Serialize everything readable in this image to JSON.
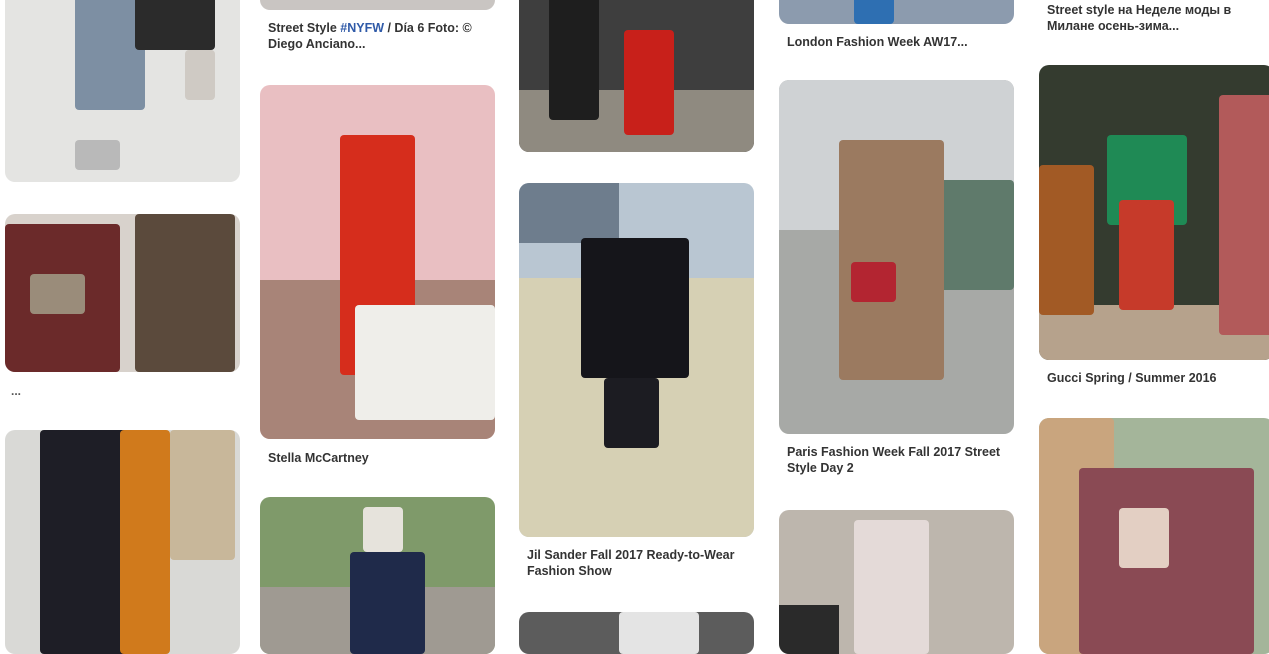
{
  "pins": [
    {
      "id": "c1-top",
      "caption": ""
    },
    {
      "id": "c1-mid",
      "caption": ""
    },
    {
      "id": "c1-bottom",
      "caption": ""
    },
    {
      "id": "c2-top",
      "caption_parts": [
        "Street Style ",
        "#NYFW",
        " / Día 6 Foto: © Diego Anciano..."
      ]
    },
    {
      "id": "c2-mid",
      "caption": "Stella McCartney"
    },
    {
      "id": "c2-bottom",
      "caption": ""
    },
    {
      "id": "c3-top",
      "caption": ""
    },
    {
      "id": "c3-mid",
      "caption": "Jil Sander Fall 2017 Ready-to-Wear Fashion Show"
    },
    {
      "id": "c3-bottom",
      "caption": ""
    },
    {
      "id": "c4-top",
      "caption": "London Fashion Week AW17..."
    },
    {
      "id": "c4-mid",
      "caption": "Paris Fashion Week Fall 2017 Street Style Day 2"
    },
    {
      "id": "c4-bottom",
      "caption": ""
    },
    {
      "id": "c5-top",
      "caption": "Street style на Неделе моды в Милане осень-зима..."
    },
    {
      "id": "c5-mid",
      "caption": "Gucci Spring / Summer 2016"
    },
    {
      "id": "c5-bottom",
      "caption": ""
    }
  ],
  "ellipsis": "...",
  "colors": {
    "caption_text": "#333333",
    "hashtag": "#2f5aa8"
  }
}
